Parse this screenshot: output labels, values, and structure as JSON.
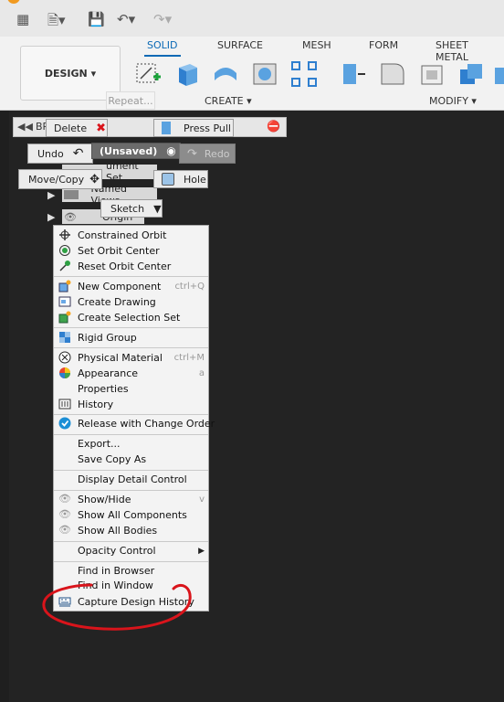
{
  "toolbar": {
    "design_label": "DESIGN",
    "repeat_label": "Repeat...",
    "tabs": [
      "SOLID",
      "SURFACE",
      "MESH",
      "FORM",
      "SHEET METAL"
    ],
    "groups": {
      "create": "CREATE",
      "modify": "MODIFY"
    }
  },
  "browser": {
    "title_partial": "BR",
    "unsaved_label": "(Unsaved)",
    "rows": [
      "ument Set",
      "Named Views",
      "Origin"
    ]
  },
  "marking_menu": {
    "delete": "Delete",
    "press_pull": "Press Pull",
    "undo": "Undo",
    "redo": "Redo",
    "move_copy": "Move/Copy",
    "hole": "Hole",
    "sketch": "Sketch"
  },
  "menu": {
    "items": [
      {
        "label": "Constrained Orbit",
        "shortcut": "",
        "icon": "constrained-orbit-icon"
      },
      {
        "label": "Set Orbit Center",
        "shortcut": "",
        "icon": "orbit-center-icon"
      },
      {
        "label": "Reset Orbit Center",
        "shortcut": "",
        "icon": "reset-orbit-icon"
      },
      {
        "label": "New Component",
        "shortcut": "ctrl+Q",
        "icon": "new-component-icon"
      },
      {
        "label": "Create Drawing",
        "shortcut": "",
        "icon": "drawing-icon"
      },
      {
        "label": "Create Selection Set",
        "shortcut": "",
        "icon": "selection-set-icon"
      },
      {
        "label": "Rigid Group",
        "shortcut": "",
        "icon": "rigid-group-icon"
      },
      {
        "label": "Physical Material",
        "shortcut": "ctrl+M",
        "icon": "physical-material-icon"
      },
      {
        "label": "Appearance",
        "shortcut": "a",
        "icon": "appearance-icon"
      },
      {
        "label": "Properties",
        "shortcut": "",
        "icon": ""
      },
      {
        "label": "History",
        "shortcut": "",
        "icon": "history-icon"
      },
      {
        "label": "Release with Change Order",
        "shortcut": "",
        "icon": "release-icon"
      },
      {
        "label": "Export...",
        "shortcut": "",
        "icon": ""
      },
      {
        "label": "Save Copy As",
        "shortcut": "",
        "icon": ""
      },
      {
        "label": "Display Detail Control",
        "shortcut": "",
        "icon": ""
      },
      {
        "label": "Show/Hide",
        "shortcut": "v",
        "icon": "eye-icon"
      },
      {
        "label": "Show All Components",
        "shortcut": "",
        "icon": "eye-icon"
      },
      {
        "label": "Show All Bodies",
        "shortcut": "",
        "icon": "eye-icon"
      },
      {
        "label": "Opacity Control",
        "shortcut": "",
        "icon": "chevron-right-icon"
      },
      {
        "label": "Find in Browser",
        "shortcut": "",
        "icon": ""
      },
      {
        "label": "Find in Window",
        "shortcut": "",
        "icon": ""
      },
      {
        "label": "Capture Design History",
        "shortcut": "",
        "icon": "capture-history-icon"
      }
    ]
  },
  "colors": {
    "accent": "#0a69b5",
    "annotation": "#d9141b"
  }
}
